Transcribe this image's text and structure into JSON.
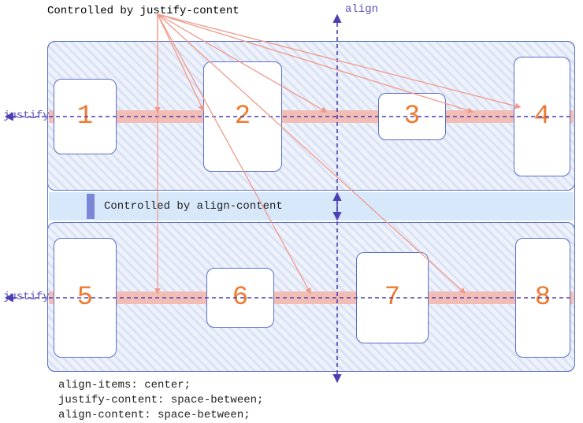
{
  "labels": {
    "top_justify": "Controlled by justify-content",
    "align_axis": "align",
    "justify_axis_1": "justify",
    "justify_axis_2": "justify",
    "align_content_gap": "Controlled by align-content"
  },
  "items": {
    "i1": "1",
    "i2": "2",
    "i3": "3",
    "i4": "4",
    "i5": "5",
    "i6": "6",
    "i7": "7",
    "i8": "8"
  },
  "css": {
    "line1": "align-items: center;",
    "line2": "justify-content: space-between;",
    "line3": "align-content: space-between;"
  },
  "colors": {
    "border": "#5a6fc9",
    "axis_bar": "#f2bdb4",
    "item_text": "#ef7a2f",
    "dashed_axis": "#4d3fb3",
    "pointer": "#f09a8a",
    "gap_fill": "#d7e8fb"
  }
}
